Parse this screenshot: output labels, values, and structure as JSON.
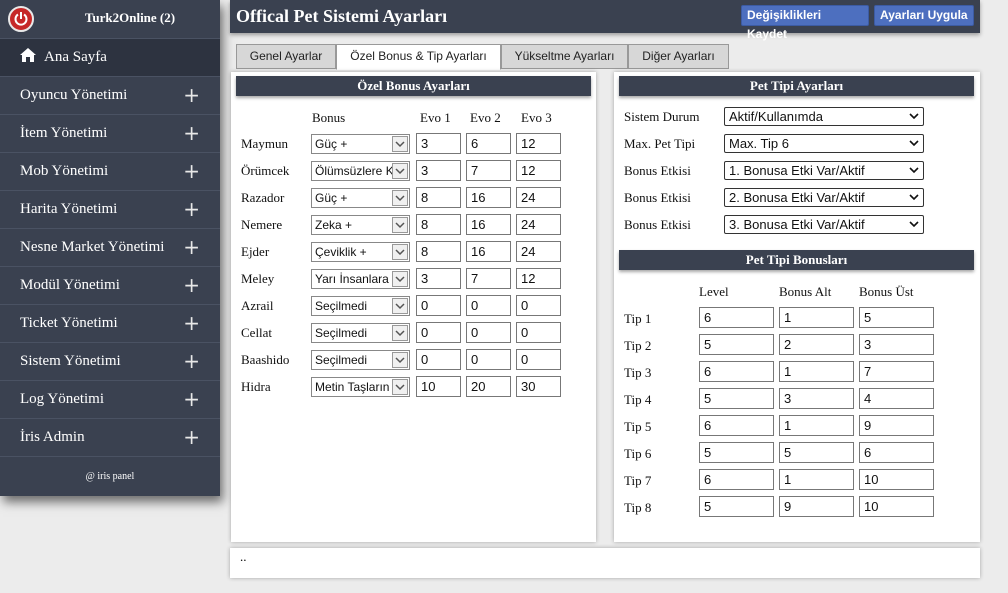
{
  "sidebar": {
    "brand": "Turk2Online (2)",
    "items": [
      {
        "label": "Ana Sayfa"
      },
      {
        "label": "Oyuncu Yönetimi"
      },
      {
        "label": "İtem Yönetimi"
      },
      {
        "label": "Mob Yönetimi"
      },
      {
        "label": "Harita Yönetimi"
      },
      {
        "label": "Nesne Market Yönetimi"
      },
      {
        "label": "Modül Yönetimi"
      },
      {
        "label": "Ticket Yönetimi"
      },
      {
        "label": "Sistem Yönetimi"
      },
      {
        "label": "Log Yönetimi"
      },
      {
        "label": "İris Admin"
      }
    ],
    "plus": "+",
    "footer": "@ iris panel"
  },
  "header": {
    "title": "Offical Pet Sistemi Ayarları",
    "save_label": "Değişiklikleri Kaydet",
    "apply_label": "Ayarları Uygula"
  },
  "tabs": [
    {
      "label": "Genel Ayarlar"
    },
    {
      "label": "Özel Bonus & Tip Ayarları"
    },
    {
      "label": "Yükseltme Ayarları"
    },
    {
      "label": "Diğer Ayarları"
    }
  ],
  "bonus_panel": {
    "title": "Özel Bonus Ayarları",
    "col_bonus": "Bonus",
    "col_evo1": "Evo 1",
    "col_evo2": "Evo 2",
    "col_evo3": "Evo 3",
    "rows": [
      {
        "name": "Maymun",
        "bonus": "Güç +",
        "evo1": "3",
        "evo2": "6",
        "evo3": "12"
      },
      {
        "name": "Örümcek",
        "bonus": "Ölümsüzlere K",
        "evo1": "3",
        "evo2": "7",
        "evo3": "12"
      },
      {
        "name": "Razador",
        "bonus": "Güç +",
        "evo1": "8",
        "evo2": "16",
        "evo3": "24"
      },
      {
        "name": "Nemere",
        "bonus": "Zeka +",
        "evo1": "8",
        "evo2": "16",
        "evo3": "24"
      },
      {
        "name": "Ejder",
        "bonus": "Çeviklik +",
        "evo1": "8",
        "evo2": "16",
        "evo3": "24"
      },
      {
        "name": "Meley",
        "bonus": "Yarı İnsanlara",
        "evo1": "3",
        "evo2": "7",
        "evo3": "12"
      },
      {
        "name": "Azrail",
        "bonus": "Seçilmedi",
        "evo1": "0",
        "evo2": "0",
        "evo3": "0"
      },
      {
        "name": "Cellat",
        "bonus": "Seçilmedi",
        "evo1": "0",
        "evo2": "0",
        "evo3": "0"
      },
      {
        "name": "Baashido",
        "bonus": "Seçilmedi",
        "evo1": "0",
        "evo2": "0",
        "evo3": "0"
      },
      {
        "name": "Hidra",
        "bonus": "Metin Taşların",
        "evo1": "10",
        "evo2": "20",
        "evo3": "30"
      }
    ]
  },
  "type_panel": {
    "title": "Pet Tipi Ayarları",
    "rows": [
      {
        "label": "Sistem Durum",
        "value": "Aktif/Kullanımda"
      },
      {
        "label": "Max. Pet Tipi",
        "value": "Max. Tip 6"
      },
      {
        "label": "Bonus Etkisi",
        "value": "1. Bonusa Etki Var/Aktif"
      },
      {
        "label": "Bonus Etkisi",
        "value": "2. Bonusa Etki Var/Aktif"
      },
      {
        "label": "Bonus Etkisi",
        "value": "3. Bonusa Etki Var/Aktif"
      }
    ]
  },
  "type_bonus_panel": {
    "title": "Pet Tipi Bonusları",
    "col_level": "Level",
    "col_alt": "Bonus Alt",
    "col_ust": "Bonus Üst",
    "rows": [
      {
        "name": "Tip 1",
        "level": "6",
        "alt": "1",
        "ust": "5"
      },
      {
        "name": "Tip 2",
        "level": "5",
        "alt": "2",
        "ust": "3"
      },
      {
        "name": "Tip 3",
        "level": "6",
        "alt": "1",
        "ust": "7"
      },
      {
        "name": "Tip 4",
        "level": "5",
        "alt": "3",
        "ust": "4"
      },
      {
        "name": "Tip 5",
        "level": "6",
        "alt": "1",
        "ust": "9"
      },
      {
        "name": "Tip 6",
        "level": "5",
        "alt": "5",
        "ust": "6"
      },
      {
        "name": "Tip 7",
        "level": "6",
        "alt": "1",
        "ust": "10"
      },
      {
        "name": "Tip 8",
        "level": "5",
        "alt": "9",
        "ust": "10"
      }
    ]
  },
  "footer": {
    "text": ".."
  },
  "colors": {
    "sidebar": "#3a4150",
    "accent_button": "#4d6fbf",
    "power": "#c62828"
  }
}
